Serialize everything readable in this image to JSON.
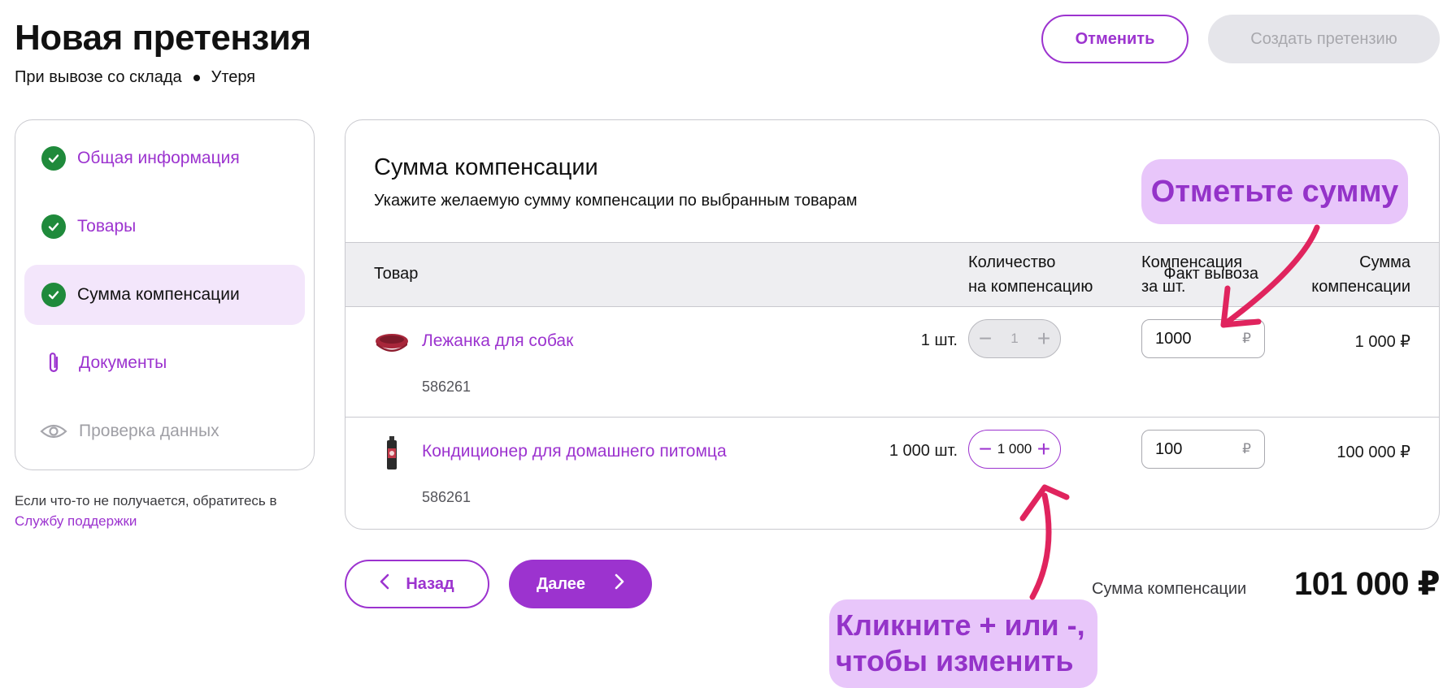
{
  "header": {
    "title": "Новая претензия",
    "subtitle_part1": "При вывозе со склада",
    "subtitle_part2": "Утеря",
    "cancel_label": "Отменить",
    "create_label": "Создать претензию"
  },
  "steps": [
    {
      "label": "Общая информация",
      "state": "done",
      "icon": "check-icon"
    },
    {
      "label": "Товары",
      "state": "done",
      "icon": "check-icon"
    },
    {
      "label": "Сумма компенсации",
      "state": "active",
      "icon": "check-icon"
    },
    {
      "label": "Документы",
      "state": "pending",
      "icon": "paperclip-icon"
    },
    {
      "label": "Проверка данных",
      "state": "disabled",
      "icon": "eye-icon"
    }
  ],
  "help": {
    "text": "Если что-то не получается, обратитесь в ",
    "link": "Службу поддержки"
  },
  "panel": {
    "title": "Сумма компенсации",
    "description": "Укажите желаемую сумму компенсации по выбранным товарам"
  },
  "table": {
    "headers": {
      "goods": "Товар",
      "fact": "Факт вывоза",
      "qty_line1": "Количество",
      "qty_line2": "на компенсацию",
      "comp_line1": "Компенсация",
      "comp_line2": "за шт.",
      "sum_line1": "Сумма",
      "sum_line2": "компенсации"
    },
    "rows": [
      {
        "name": "Лежанка для собак",
        "sku": "586261",
        "fact": "1 шт.",
        "qty": "1",
        "qty_enabled": false,
        "price": "1000",
        "currency": "₽",
        "sum": "1 000 ₽",
        "thumb": "dog-bed-image"
      },
      {
        "name": "Кондиционер для домашнего питомца",
        "sku": "586261",
        "fact": "1 000 шт.",
        "qty": "1 000",
        "qty_enabled": true,
        "price": "100",
        "currency": "₽",
        "sum": "100 000 ₽",
        "thumb": "pet-conditioner-bottle-image"
      }
    ]
  },
  "footer": {
    "back_label": "Назад",
    "next_label": "Далее",
    "total_label": "Сумма компенсации",
    "total_value": "101 000 ₽"
  },
  "tips": {
    "tip1": "Отметьте сумму",
    "tip2_line1": "Кликните + или -,",
    "tip2_line2": "чтобы изменить"
  },
  "colors": {
    "accent": "#9c33cf",
    "success": "#1f8a3b",
    "tip_bg": "#e8c6fa",
    "arrow": "#e0245e"
  }
}
